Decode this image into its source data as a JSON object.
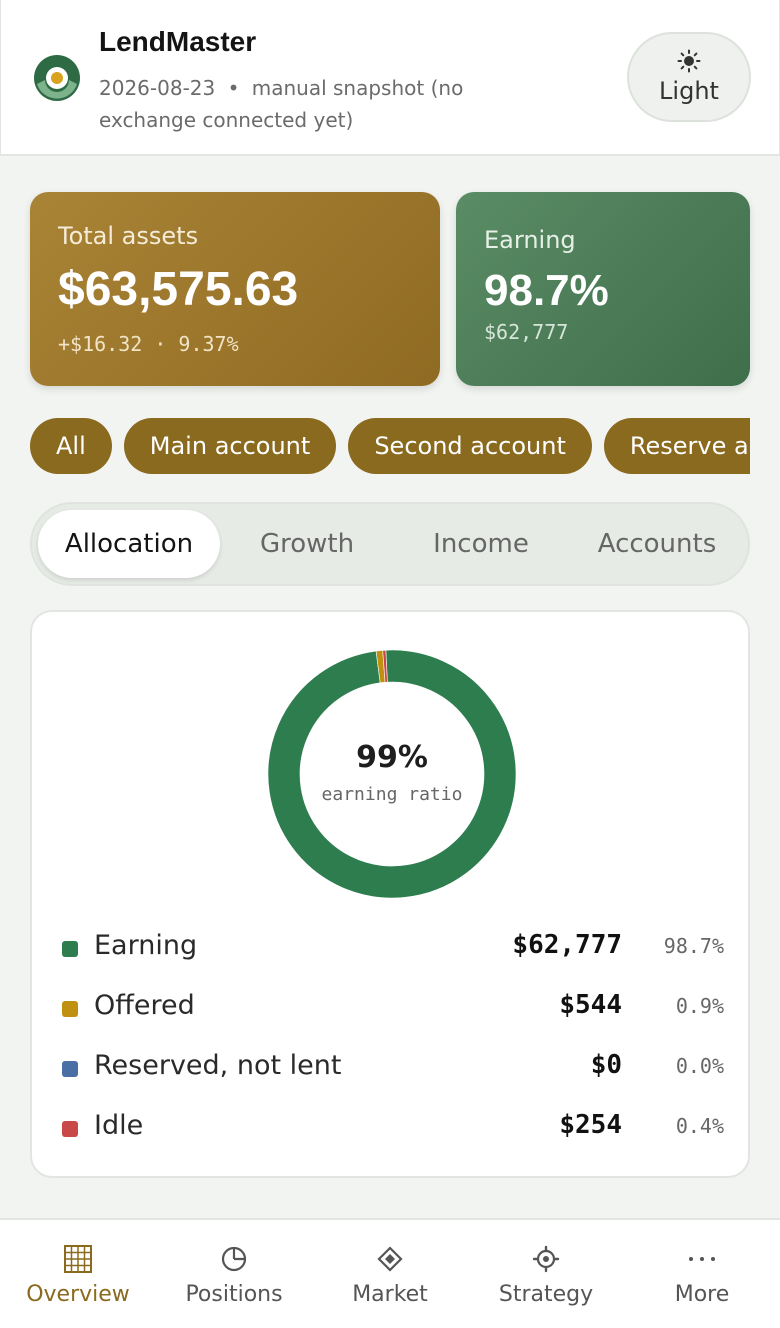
{
  "header": {
    "app_title": "LendMaster",
    "date": "2026-08-23",
    "separator": "•",
    "note": "manual snapshot (no exchange connected yet)",
    "theme_button": {
      "icon": "sun-icon",
      "label": "Light"
    }
  },
  "kpis": {
    "total": {
      "label": "Total assets",
      "value": "$63,575.63",
      "sub": "+$16.32 · 9.37%"
    },
    "earning": {
      "label": "Earning",
      "value": "98.7%",
      "sub": "$62,777"
    }
  },
  "account_chips": [
    "All",
    "Main account",
    "Second account",
    "Reserve acco"
  ],
  "tabs": {
    "active": "Allocation",
    "items": [
      "Allocation",
      "Growth",
      "Income",
      "Accounts"
    ]
  },
  "allocation": {
    "center_value": "99%",
    "center_label": "earning ratio",
    "rows": [
      {
        "name": "Earning",
        "amount": "$62,777",
        "pct": "98.7%"
      },
      {
        "name": "Offered",
        "amount": "$544",
        "pct": "0.9%"
      },
      {
        "name": "Reserved, not lent",
        "amount": "$0",
        "pct": "0.0%"
      },
      {
        "name": "Idle",
        "amount": "$254",
        "pct": "0.4%"
      }
    ]
  },
  "chart_data": {
    "type": "pie",
    "categories": [
      "Earning",
      "Offered",
      "Reserved, not lent",
      "Idle"
    ],
    "values": [
      62777,
      544,
      0,
      254
    ],
    "colors": [
      "#2e7d4f",
      "#c09010",
      "#4a6fa5",
      "#c94848"
    ]
  },
  "colors": {
    "accent": "#8a6a1e",
    "earning": "#2e7d4f",
    "offered": "#c09010",
    "reserved": "#4a6fa5",
    "idle": "#c94848"
  },
  "nav": {
    "active": "Overview",
    "items": [
      {
        "label": "Overview",
        "icon": "grid-icon"
      },
      {
        "label": "Positions",
        "icon": "pie-icon"
      },
      {
        "label": "Market",
        "icon": "diamond-icon"
      },
      {
        "label": "Strategy",
        "icon": "gear-icon"
      },
      {
        "label": "More",
        "icon": "more-icon"
      }
    ]
  }
}
